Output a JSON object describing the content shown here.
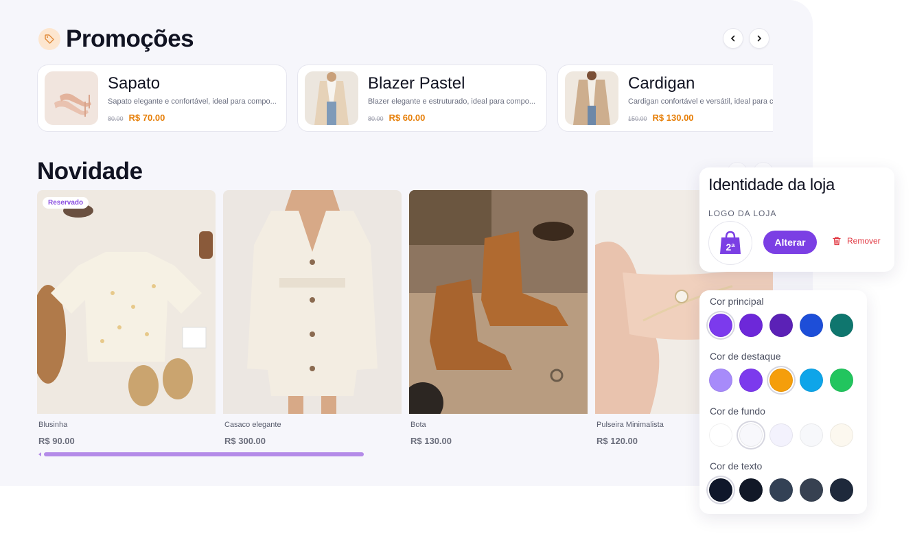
{
  "promotions": {
    "title": "Promoções",
    "cards": [
      {
        "name": "Sapato",
        "description": "Sapato elegante e confortável, ideal para compo...",
        "old_price": "80.00",
        "price": "R$ 70.00"
      },
      {
        "name": "Blazer Pastel",
        "description": "Blazer elegante e estruturado, ideal para compo...",
        "old_price": "80.00",
        "price": "R$ 60.00"
      },
      {
        "name": "Cardigan",
        "description": "Cardigan confortável e versátil, ideal para c",
        "old_price": "150.00",
        "price": "R$ 130.00"
      }
    ]
  },
  "new_section": {
    "title": "Novidade",
    "products": [
      {
        "name": "Blusinha",
        "price": "R$ 90.00",
        "badge": "Reservado"
      },
      {
        "name": "Casaco elegante",
        "price": "R$ 300.00"
      },
      {
        "name": "Bota",
        "price": "R$ 130.00"
      },
      {
        "name": "Pulseira Minimalista",
        "price": "R$ 120.00"
      }
    ]
  },
  "identity": {
    "title": "Identidade da loja",
    "logo_label": "LOGO DA LOJA",
    "logo_text": "2ª",
    "change_label": "Alterar",
    "remove_label": "Remover"
  },
  "colors": {
    "groups": [
      {
        "label": "Cor principal",
        "swatches": [
          "#7c3aed",
          "#6d28d9",
          "#5b21b6",
          "#1d4ed8",
          "#0f766e"
        ],
        "selected": 0
      },
      {
        "label": "Cor de destaque",
        "swatches": [
          "#a78bfa",
          "#7c3aed",
          "#f59e0b",
          "#0ea5e9",
          "#22c55e"
        ],
        "selected": 2
      },
      {
        "label": "Cor de fundo",
        "swatches": [
          "#ffffff",
          "#f8f8fc",
          "#f3f2fd",
          "#f7f8fb",
          "#fcf8ef"
        ],
        "selected": 1
      },
      {
        "label": "Cor de texto",
        "swatches": [
          "#0f172a",
          "#111827",
          "#334155",
          "#374151",
          "#1e293b"
        ],
        "selected": 0
      }
    ]
  },
  "theme": {
    "accent": "#7b3fe4",
    "price_orange": "#e67e07",
    "danger": "#e0333d",
    "scroll_purple": "#b48be8"
  }
}
